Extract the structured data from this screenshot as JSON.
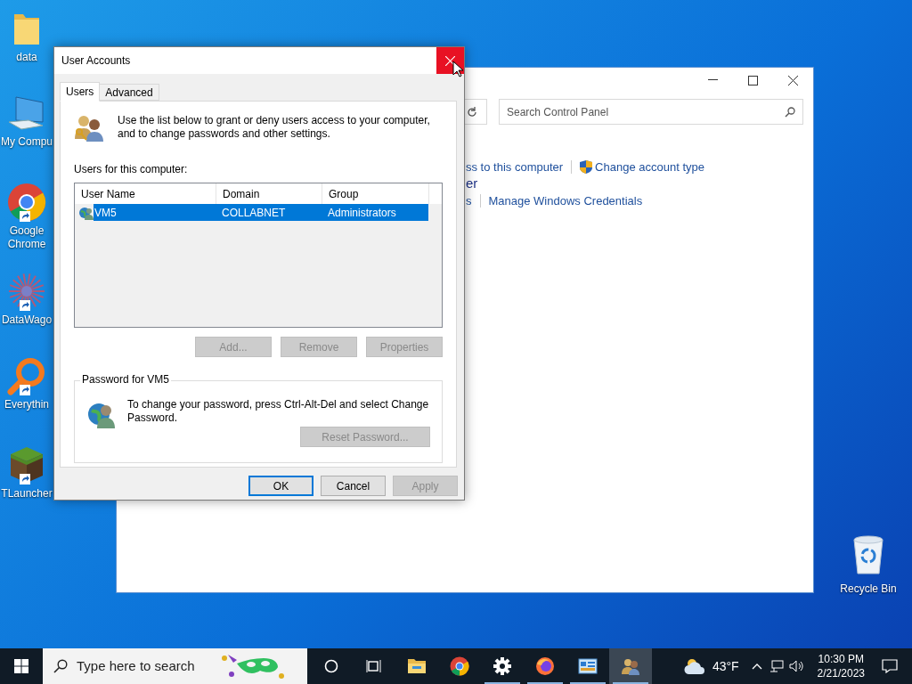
{
  "desktop_icons": [
    {
      "kind": "folder",
      "label": "data",
      "shortcut": false
    },
    {
      "kind": "computer",
      "label": "My Compu",
      "shortcut": false
    },
    {
      "kind": "chrome",
      "label": "Google Chrome",
      "shortcut": true
    },
    {
      "kind": "datawagon",
      "label": "DataWago",
      "shortcut": true
    },
    {
      "kind": "everything",
      "label": "Everythin",
      "shortcut": true
    },
    {
      "kind": "grass",
      "label": "TLauncher",
      "shortcut": true
    }
  ],
  "recycle_bin": {
    "label": "Recycle Bin"
  },
  "control_panel": {
    "search": {
      "placeholder": "Search Control Panel"
    },
    "rows": [
      [
        {
          "kind": "fragment",
          "text": "ss to this computer"
        },
        {
          "kind": "shield-link",
          "text": "Change account type"
        }
      ],
      [
        {
          "kind": "heading-fragment",
          "text": "er"
        }
      ],
      [
        {
          "kind": "fragment",
          "text": "s"
        },
        {
          "kind": "link",
          "text": "Manage Windows Credentials"
        }
      ]
    ]
  },
  "dialog": {
    "title": "User Accounts",
    "tabs": [
      {
        "label": "Users",
        "selected": true
      },
      {
        "label": "Advanced",
        "selected": false
      }
    ],
    "intro": "Use the list below to grant or deny users access to your computer, and to change passwords and other settings.",
    "list_label": "Users for this computer:",
    "columns": [
      "User Name",
      "Domain",
      "Group"
    ],
    "rows": [
      {
        "cells": [
          "VM5",
          "COLLABNET",
          "Administrators"
        ],
        "selected": true
      }
    ],
    "list_buttons": [
      {
        "label": "Add...",
        "disabled": true
      },
      {
        "label": "Remove",
        "disabled": true
      },
      {
        "label": "Properties",
        "disabled": true
      }
    ],
    "password_group": {
      "title": "Password for VM5",
      "text": "To change your password, press Ctrl-Alt-Del and select Change Password.",
      "button": {
        "label": "Reset Password...",
        "disabled": true
      }
    },
    "footer_buttons": [
      {
        "label": "OK",
        "disabled": false,
        "default": true
      },
      {
        "label": "Cancel",
        "disabled": false,
        "default": false
      },
      {
        "label": "Apply",
        "disabled": true,
        "default": false
      }
    ]
  },
  "taskbar": {
    "search": {
      "placeholder": "Type here to search"
    },
    "apps": [
      {
        "kind": "cortana",
        "open": false,
        "active": false
      },
      {
        "kind": "taskview",
        "open": false,
        "active": false
      },
      {
        "kind": "explorer",
        "open": false,
        "active": false
      },
      {
        "kind": "chrome",
        "open": false,
        "active": false
      },
      {
        "kind": "settings",
        "open": true,
        "active": false
      },
      {
        "kind": "firefox",
        "open": true,
        "active": false
      },
      {
        "kind": "controlpanel",
        "open": true,
        "active": false
      },
      {
        "kind": "users",
        "open": true,
        "active": true
      }
    ],
    "weather": {
      "temperature": "43°F"
    },
    "clock": {
      "time": "10:30 PM",
      "date": "2/21/2023"
    }
  }
}
